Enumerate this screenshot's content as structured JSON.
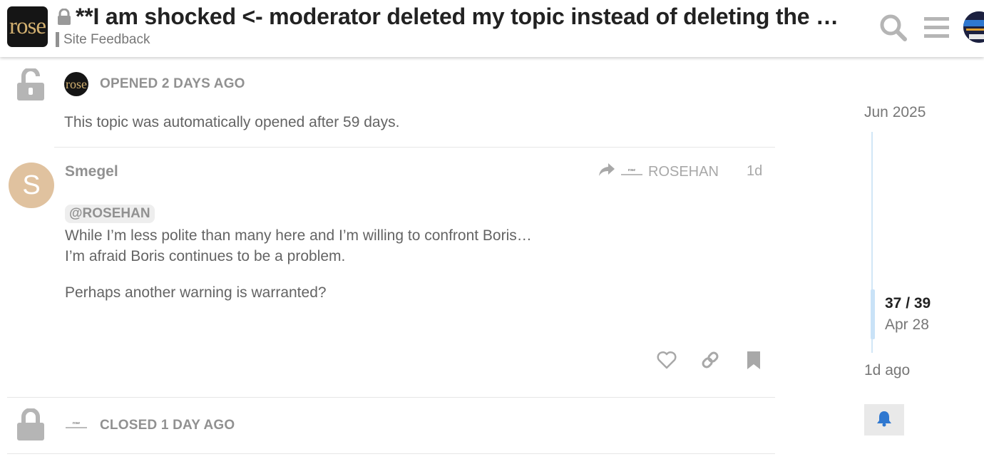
{
  "header": {
    "logo_text": "rose",
    "title": "**I am shocked <- moderator deleted my topic instead of deleting the bad remarks from Boris",
    "category": "Site Feedback"
  },
  "posts": {
    "opened_action": {
      "label": "OPENED 2 DAYS AGO",
      "avatar_text": "rose",
      "description": "This topic was automatically opened after 59 days."
    },
    "reply": {
      "avatar_letter": "S",
      "username": "Smegel",
      "reply_to_user": "ROSEHAN",
      "reply_to_logo": "rose",
      "date": "1d",
      "mention": "@ROSEHAN",
      "lines": [
        "While I’m less polite than many here and I’m willing to confront Boris…",
        "I’m afraid Boris continues to be a problem.",
        "Perhaps another warning is warranted?"
      ]
    },
    "closed_action": {
      "label": "CLOSED 1 DAY AGO",
      "avatar_text": "rose"
    }
  },
  "timeline": {
    "top_date": "Jun 2025",
    "position": "37 / 39",
    "current_date": "Apr 28",
    "bottom_label": "1d ago",
    "progress_fraction": 0.949
  },
  "icons": {
    "title": "lock-icon",
    "search": "search-icon",
    "menu": "hamburger-menu-icon",
    "opened": "unlock-icon",
    "closed": "lock-icon",
    "reply": "share-arrow-icon",
    "like": "heart-icon",
    "link": "link-icon",
    "bookmark": "bookmark-icon",
    "notification": "bell-icon"
  },
  "colors": {
    "accent_blue": "#2f78d0",
    "muted_gray": "#919191",
    "avatar_tan": "#e0c29f"
  }
}
